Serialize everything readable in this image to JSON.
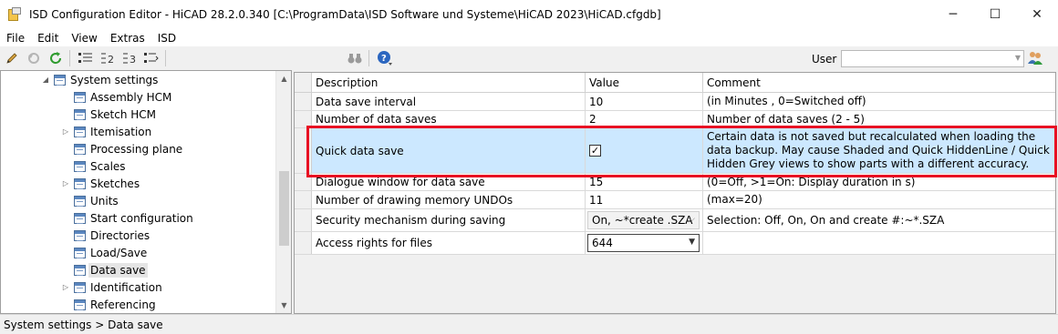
{
  "window": {
    "title": "ISD Configuration Editor  -  HiCAD 28.2.0.340 [C:\\ProgramData\\ISD Software und Systeme\\HiCAD 2023\\HiCAD.cfgdb]",
    "minimize": "─",
    "maximize": "☐",
    "close": "✕"
  },
  "menu": [
    "File",
    "Edit",
    "View",
    "Extras",
    "ISD"
  ],
  "toolbar": {
    "user_label": "User",
    "user_value": ""
  },
  "tree": {
    "items": [
      {
        "label": "System settings",
        "expander": "◢",
        "selected": false
      },
      {
        "label": "Assembly HCM",
        "expander": "",
        "selected": false
      },
      {
        "label": "Sketch HCM",
        "expander": "",
        "selected": false
      },
      {
        "label": "Itemisation",
        "expander": "▷",
        "selected": false
      },
      {
        "label": "Processing plane",
        "expander": "",
        "selected": false
      },
      {
        "label": "Scales",
        "expander": "",
        "selected": false
      },
      {
        "label": "Sketches",
        "expander": "▷",
        "selected": false
      },
      {
        "label": "Units",
        "expander": "",
        "selected": false
      },
      {
        "label": "Start configuration",
        "expander": "",
        "selected": false
      },
      {
        "label": "Directories",
        "expander": "",
        "selected": false
      },
      {
        "label": "Load/Save",
        "expander": "",
        "selected": false
      },
      {
        "label": "Data save",
        "expander": "",
        "selected": true
      },
      {
        "label": "Identification",
        "expander": "▷",
        "selected": false
      },
      {
        "label": "Referencing",
        "expander": "",
        "selected": false
      }
    ]
  },
  "grid": {
    "headers": {
      "description": "Description",
      "value": "Value",
      "comment": "Comment"
    },
    "rows": [
      {
        "description": "Data save interval",
        "value": "10",
        "comment": "(in Minutes , 0=Switched off)"
      },
      {
        "description": "Number of data saves",
        "value": "2",
        "comment": "Number of data saves (2 - 5)"
      },
      {
        "description": "Quick data save",
        "value": "✓",
        "comment": "Certain data is not saved but recalculated when loading the data backup. May cause Shaded and Quick HiddenLine / Quick Hidden Grey views to show parts with a different accuracy."
      },
      {
        "description": "Dialogue window for data save",
        "value": "15",
        "comment": "(0=Off, >1=On: Display duration in s)"
      },
      {
        "description": "Number of drawing memory UNDOs",
        "value": "11",
        "comment": "(max=20)"
      },
      {
        "description": "Security mechanism during saving",
        "value": "On, ~*create .SZA",
        "comment": "Selection: Off, On, On and create #:~*.SZA"
      },
      {
        "description": "Access rights for files",
        "value": "644",
        "comment": ""
      }
    ]
  },
  "status": {
    "path": "System settings > Data save"
  }
}
